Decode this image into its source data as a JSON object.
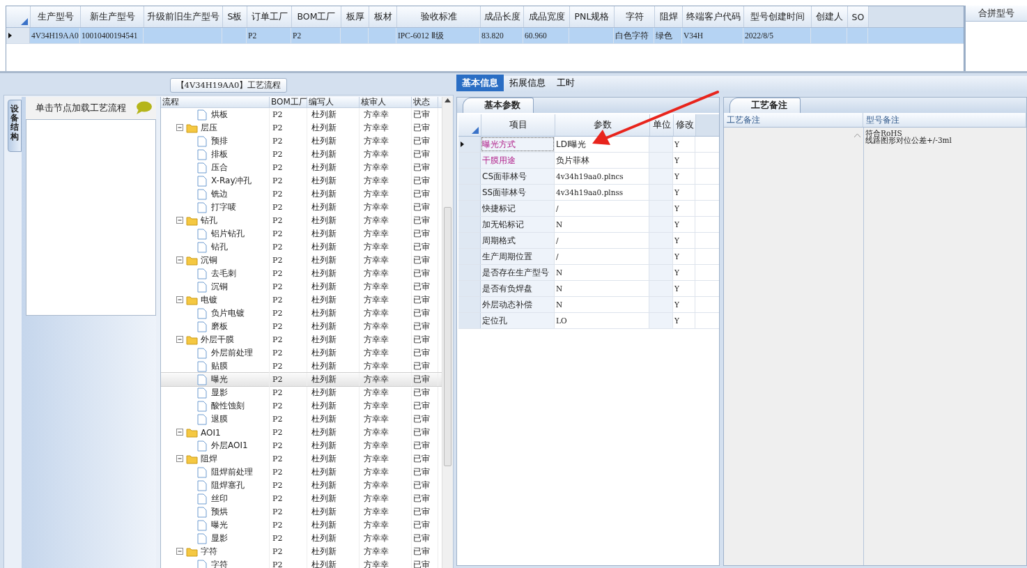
{
  "top_grid": {
    "columns": [
      "生产型号",
      "新生产型号",
      "升级前旧生产型号",
      "S板",
      "订单工厂",
      "BOM工厂",
      "板厚",
      "板材",
      "验收标准",
      "成品长度",
      "成品宽度",
      "PNL规格",
      "字符",
      "阻焊",
      "终端客户代码",
      "型号创建时间",
      "创建人",
      "SO"
    ],
    "rows": [
      {
        "selected": true,
        "cells": [
          "4V34H19AA0",
          "10010400194541",
          "",
          "",
          "P2",
          "P2",
          "",
          "",
          "IPC-6012 Ⅱ级",
          "83.820",
          "60.960",
          "",
          "白色字符",
          "绿色",
          "V34H",
          "2022/8/5",
          "",
          ""
        ]
      }
    ]
  },
  "merge_panel": {
    "title": "合拼型号"
  },
  "process_panel": {
    "title": "【4V34H19AA0】工艺流程",
    "side_tab": "设备结构",
    "hint": "单击节点加载工艺流程",
    "columns": [
      "流程",
      "BOM工厂",
      "编写人",
      "核审人",
      "状态"
    ],
    "rows": [
      {
        "kind": "step",
        "name": "烘板",
        "factory": "P2",
        "writer": "杜列新",
        "reviewer": "方幸幸",
        "status": "已审",
        "selected": false
      },
      {
        "kind": "group",
        "name": "层压",
        "factory": "P2",
        "writer": "杜列新",
        "reviewer": "方幸幸",
        "status": "已审",
        "selected": false,
        "expanded": true,
        "children": [
          {
            "kind": "step",
            "name": "预排",
            "factory": "P2",
            "writer": "杜列新",
            "reviewer": "方幸幸",
            "status": "已审",
            "selected": false
          },
          {
            "kind": "step",
            "name": "排板",
            "factory": "P2",
            "writer": "杜列新",
            "reviewer": "方幸幸",
            "status": "已审",
            "selected": false
          },
          {
            "kind": "step",
            "name": "压合",
            "factory": "P2",
            "writer": "杜列新",
            "reviewer": "方幸幸",
            "status": "已审",
            "selected": false
          },
          {
            "kind": "step",
            "name": "X-Ray冲孔",
            "factory": "P2",
            "writer": "杜列新",
            "reviewer": "方幸幸",
            "status": "已审",
            "selected": false
          },
          {
            "kind": "step",
            "name": "铣边",
            "factory": "P2",
            "writer": "杜列新",
            "reviewer": "方幸幸",
            "status": "已审",
            "selected": false
          },
          {
            "kind": "step",
            "name": "打字唛",
            "factory": "P2",
            "writer": "杜列新",
            "reviewer": "方幸幸",
            "status": "已审",
            "selected": false
          }
        ]
      },
      {
        "kind": "group",
        "name": "钻孔",
        "factory": "P2",
        "writer": "杜列新",
        "reviewer": "方幸幸",
        "status": "已审",
        "selected": false,
        "expanded": true,
        "children": [
          {
            "kind": "step",
            "name": "铝片钻孔",
            "factory": "P2",
            "writer": "杜列新",
            "reviewer": "方幸幸",
            "status": "已审",
            "selected": false
          },
          {
            "kind": "step",
            "name": "钻孔",
            "factory": "P2",
            "writer": "杜列新",
            "reviewer": "方幸幸",
            "status": "已审",
            "selected": false
          }
        ]
      },
      {
        "kind": "group",
        "name": "沉铜",
        "factory": "P2",
        "writer": "杜列新",
        "reviewer": "方幸幸",
        "status": "已审",
        "selected": false,
        "expanded": true,
        "children": [
          {
            "kind": "step",
            "name": "去毛刺",
            "factory": "P2",
            "writer": "杜列新",
            "reviewer": "方幸幸",
            "status": "已审",
            "selected": false
          },
          {
            "kind": "step",
            "name": "沉铜",
            "factory": "P2",
            "writer": "杜列新",
            "reviewer": "方幸幸",
            "status": "已审",
            "selected": false
          }
        ]
      },
      {
        "kind": "group",
        "name": "电镀",
        "factory": "P2",
        "writer": "杜列新",
        "reviewer": "方幸幸",
        "status": "已审",
        "selected": false,
        "expanded": true,
        "children": [
          {
            "kind": "step",
            "name": "负片电镀",
            "factory": "P2",
            "writer": "杜列新",
            "reviewer": "方幸幸",
            "status": "已审",
            "selected": false
          },
          {
            "kind": "step",
            "name": "磨板",
            "factory": "P2",
            "writer": "杜列新",
            "reviewer": "方幸幸",
            "status": "已审",
            "selected": false
          }
        ]
      },
      {
        "kind": "group",
        "name": "外层干膜",
        "factory": "P2",
        "writer": "杜列新",
        "reviewer": "方幸幸",
        "status": "已审",
        "selected": false,
        "expanded": true,
        "children": [
          {
            "kind": "step",
            "name": "外层前处理",
            "factory": "P2",
            "writer": "杜列新",
            "reviewer": "方幸幸",
            "status": "已审",
            "selected": false
          },
          {
            "kind": "step",
            "name": "贴膜",
            "factory": "P2",
            "writer": "杜列新",
            "reviewer": "方幸幸",
            "status": "已审",
            "selected": false
          },
          {
            "kind": "step",
            "name": "曝光",
            "factory": "P2",
            "writer": "杜列新",
            "reviewer": "方幸幸",
            "status": "已审",
            "selected": true
          },
          {
            "kind": "step",
            "name": "显影",
            "factory": "P2",
            "writer": "杜列新",
            "reviewer": "方幸幸",
            "status": "已审",
            "selected": false
          },
          {
            "kind": "step",
            "name": "酸性蚀刻",
            "factory": "P2",
            "writer": "杜列新",
            "reviewer": "方幸幸",
            "status": "已审",
            "selected": false
          },
          {
            "kind": "step",
            "name": "退膜",
            "factory": "P2",
            "writer": "杜列新",
            "reviewer": "方幸幸",
            "status": "已审",
            "selected": false
          }
        ]
      },
      {
        "kind": "group",
        "name": "AOI1",
        "factory": "P2",
        "writer": "杜列新",
        "reviewer": "方幸幸",
        "status": "已审",
        "selected": false,
        "expanded": true,
        "children": [
          {
            "kind": "step",
            "name": "外层AOI1",
            "factory": "P2",
            "writer": "杜列新",
            "reviewer": "方幸幸",
            "status": "已审",
            "selected": false
          }
        ]
      },
      {
        "kind": "group",
        "name": "阻焊",
        "factory": "P2",
        "writer": "杜列新",
        "reviewer": "方幸幸",
        "status": "已审",
        "selected": false,
        "expanded": true,
        "children": [
          {
            "kind": "step",
            "name": "阻焊前处理",
            "factory": "P2",
            "writer": "杜列新",
            "reviewer": "方幸幸",
            "status": "已审",
            "selected": false
          },
          {
            "kind": "step",
            "name": "阻焊塞孔",
            "factory": "P2",
            "writer": "杜列新",
            "reviewer": "方幸幸",
            "status": "已审",
            "selected": false
          },
          {
            "kind": "step",
            "name": "丝印",
            "factory": "P2",
            "writer": "杜列新",
            "reviewer": "方幸幸",
            "status": "已审",
            "selected": false
          },
          {
            "kind": "step",
            "name": "预烘",
            "factory": "P2",
            "writer": "杜列新",
            "reviewer": "方幸幸",
            "status": "已审",
            "selected": false
          },
          {
            "kind": "step",
            "name": "曝光",
            "factory": "P2",
            "writer": "杜列新",
            "reviewer": "方幸幸",
            "status": "已审",
            "selected": false
          },
          {
            "kind": "step",
            "name": "显影",
            "factory": "P2",
            "writer": "杜列新",
            "reviewer": "方幸幸",
            "status": "已审",
            "selected": false
          }
        ]
      },
      {
        "kind": "group",
        "name": "字符",
        "factory": "P2",
        "writer": "杜列新",
        "reviewer": "方幸幸",
        "status": "已审",
        "selected": false,
        "expanded": true,
        "children": [
          {
            "kind": "step",
            "name": "字符",
            "factory": "P2",
            "writer": "杜列新",
            "reviewer": "方幸幸",
            "status": "已审",
            "selected": false
          }
        ]
      }
    ]
  },
  "tabs": [
    {
      "label": "基本信息",
      "selected": true
    },
    {
      "label": "拓展信息",
      "selected": false
    },
    {
      "label": "工时",
      "selected": false
    }
  ],
  "params_panel": {
    "title": "基本参数",
    "columns": [
      "项目",
      "参数",
      "单位",
      "修改"
    ],
    "rows": [
      {
        "item": "曝光方式",
        "value": "LDI曝光",
        "modify": "Y",
        "highlighted": true,
        "selected": true
      },
      {
        "item": "干膜用途",
        "value": "负片菲林",
        "modify": "Y",
        "highlighted": true,
        "selected": false
      },
      {
        "item": "CS面菲林号",
        "value": "4v34h19aa0.plncs",
        "modify": "Y",
        "highlighted": false,
        "selected": false
      },
      {
        "item": "SS面菲林号",
        "value": "4v34h19aa0.plnss",
        "modify": "Y",
        "highlighted": false,
        "selected": false
      },
      {
        "item": "快捷标记",
        "value": "/",
        "modify": "Y",
        "highlighted": false,
        "selected": false
      },
      {
        "item": "加无铅标记",
        "value": "N",
        "modify": "Y",
        "highlighted": false,
        "selected": false
      },
      {
        "item": "周期格式",
        "value": "/",
        "modify": "Y",
        "highlighted": false,
        "selected": false
      },
      {
        "item": "生产周期位置",
        "value": "/",
        "modify": "Y",
        "highlighted": false,
        "selected": false
      },
      {
        "item": "是否存在生产型号",
        "value": "N",
        "modify": "Y",
        "highlighted": false,
        "selected": false
      },
      {
        "item": "是否有负焊盘",
        "value": "N",
        "modify": "Y",
        "highlighted": false,
        "selected": false
      },
      {
        "item": "外层动态补偿",
        "value": "N",
        "modify": "Y",
        "highlighted": false,
        "selected": false
      },
      {
        "item": "定位孔",
        "value": "LO",
        "modify": "Y",
        "highlighted": false,
        "selected": false
      }
    ]
  },
  "notes_panel": {
    "title": "工艺备注",
    "columns": [
      "工艺备注",
      "型号备注"
    ],
    "model_notes": [
      "符合RoHS",
      "线路图形对位公差+/-3ml"
    ]
  }
}
